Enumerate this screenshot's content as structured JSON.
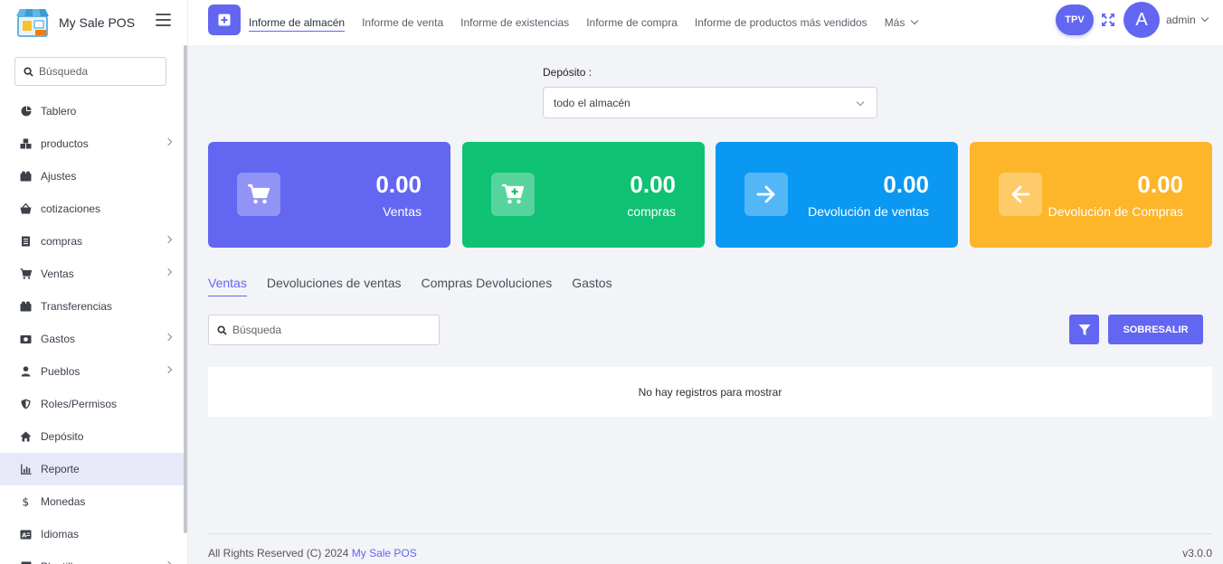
{
  "app": {
    "name": "My Sale POS"
  },
  "sidebar": {
    "search_placeholder": "Búsqueda",
    "items": [
      {
        "label": "Tablero",
        "icon": "pie-chart-icon",
        "has_children": false,
        "active": false
      },
      {
        "label": "productos",
        "icon": "boxes-icon",
        "has_children": true,
        "active": false
      },
      {
        "label": "Ajustes",
        "icon": "adjust-icon",
        "has_children": false,
        "active": false
      },
      {
        "label": "cotizaciones",
        "icon": "basket-icon",
        "has_children": false,
        "active": false
      },
      {
        "label": "compras",
        "icon": "receipt-icon",
        "has_children": true,
        "active": false
      },
      {
        "label": "Ventas",
        "icon": "cart-icon",
        "has_children": true,
        "active": false
      },
      {
        "label": "Transferencias",
        "icon": "transfer-icon",
        "has_children": false,
        "active": false
      },
      {
        "label": "Gastos",
        "icon": "money-icon",
        "has_children": true,
        "active": false
      },
      {
        "label": "Pueblos",
        "icon": "user-icon",
        "has_children": true,
        "active": false
      },
      {
        "label": "Roles/Permisos",
        "icon": "shield-icon",
        "has_children": false,
        "active": false
      },
      {
        "label": "Depósito",
        "icon": "home-icon",
        "has_children": false,
        "active": false
      },
      {
        "label": "Reporte",
        "icon": "bar-chart-icon",
        "has_children": false,
        "active": true
      },
      {
        "label": "Monedas",
        "icon": "dollar-icon",
        "has_children": false,
        "active": false
      },
      {
        "label": "Idiomas",
        "icon": "language-icon",
        "has_children": false,
        "active": false
      },
      {
        "label": "Plantillas",
        "icon": "template-icon",
        "has_children": true,
        "active": false
      }
    ]
  },
  "topbar": {
    "tabs": [
      {
        "label": "Informe de almacén",
        "active": true
      },
      {
        "label": "Informe de venta",
        "active": false
      },
      {
        "label": "Informe de existencias",
        "active": false
      },
      {
        "label": "Informe de compra",
        "active": false
      },
      {
        "label": "Informe de productos más vendidos",
        "active": false
      }
    ],
    "more_label": "Más",
    "tpv_label": "TPV",
    "avatar_initial": "A",
    "user_name": "admin"
  },
  "filter": {
    "label": "Depósito :",
    "selected": "todo el almacén"
  },
  "cards": [
    {
      "value": "0.00",
      "label": "Ventas",
      "color": "#6366f1",
      "icon": "cart-icon"
    },
    {
      "value": "0.00",
      "label": "compras",
      "color": "#0fc273",
      "icon": "cart-plus-icon"
    },
    {
      "value": "0.00",
      "label": "Devolución de ventas",
      "color": "#0a98f2",
      "icon": "arrow-right-icon"
    },
    {
      "value": "0.00",
      "label": "Devolución de Compras",
      "color": "#fdb52a",
      "icon": "arrow-left-icon"
    }
  ],
  "report_tabs": [
    {
      "label": "Ventas",
      "active": true
    },
    {
      "label": "Devoluciones de ventas",
      "active": false
    },
    {
      "label": "Compras Devoluciones",
      "active": false
    },
    {
      "label": "Gastos",
      "active": false
    }
  ],
  "table": {
    "search_placeholder": "Búsqueda",
    "excel_label": "SOBRESALIR",
    "empty_message": "No hay registros para mostrar"
  },
  "footer": {
    "copyright": "All Rights Reserved (C) 2024",
    "brand": "My Sale POS",
    "version": "v3.0.0"
  }
}
